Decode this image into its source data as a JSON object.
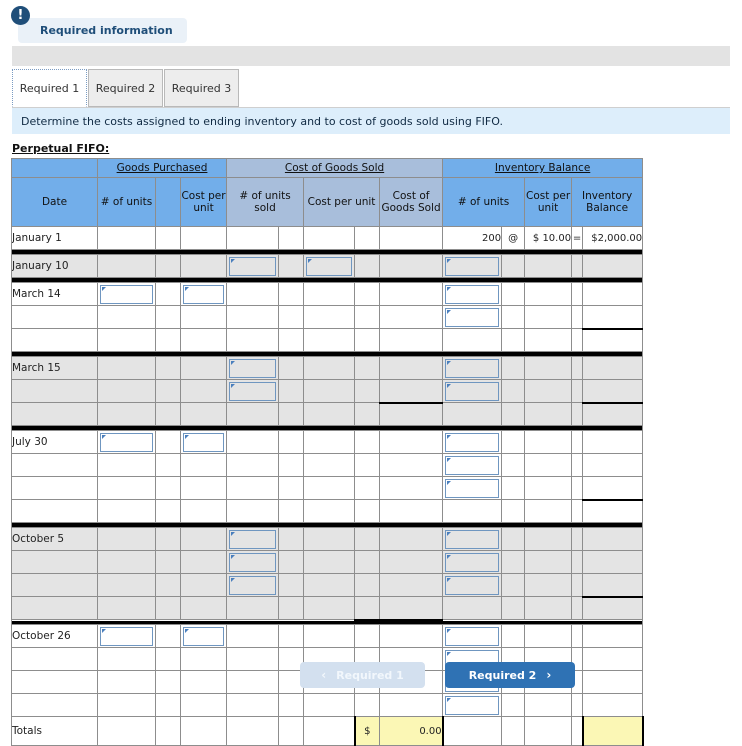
{
  "alert": {
    "icon": "exclamation-icon",
    "label": "Required information"
  },
  "tabs": [
    {
      "label": "Required 1",
      "active": true
    },
    {
      "label": "Required 2",
      "active": false
    },
    {
      "label": "Required 3",
      "active": false
    }
  ],
  "prompt": "Determine the costs assigned to ending inventory and to cost of goods sold using FIFO.",
  "section_label": "Perpetual FIFO:",
  "table": {
    "groups": {
      "date": "Date",
      "goods_purchased": "Goods Purchased",
      "cost_of_goods_sold": "Cost of Goods Sold",
      "inventory_balance": "Inventory Balance"
    },
    "headers": {
      "gp_units": "# of units",
      "gp_cost_per_unit": "Cost per unit",
      "cogs_units_sold": "# of units sold",
      "cogs_cost_per_unit": "Cost per unit",
      "cogs_total": "Cost of Goods Sold",
      "ib_units": "# of units",
      "ib_cost_per_unit": "Cost per unit",
      "ib_balance": "Inventory Balance"
    },
    "opening_row": {
      "date": "January 1",
      "ib_units": "200",
      "at_symbol": "@",
      "ib_cost_per_unit": "$ 10.00",
      "equals_symbol": "=",
      "ib_balance": "$2,000.00"
    },
    "dates": {
      "january_10": "January 10",
      "march_14": "March 14",
      "march_15": "March 15",
      "july_30": "July 30",
      "october_5": "October 5",
      "october_26": "October 26",
      "totals": "Totals"
    },
    "totals_row": {
      "currency_symbol": "$",
      "cogs_total": "0.00",
      "ib_balance": ""
    }
  },
  "nav": {
    "prev_label": "Required 1",
    "prev_chevron": "‹",
    "next_label": "Required 2",
    "next_chevron": "›"
  },
  "colors": {
    "group_blue": "#72aeea",
    "group_gray_blue": "#a8bedb",
    "prompt_bg": "#ddeefb",
    "accent": "#2f72b4",
    "yellow": "#fbf7b5"
  }
}
